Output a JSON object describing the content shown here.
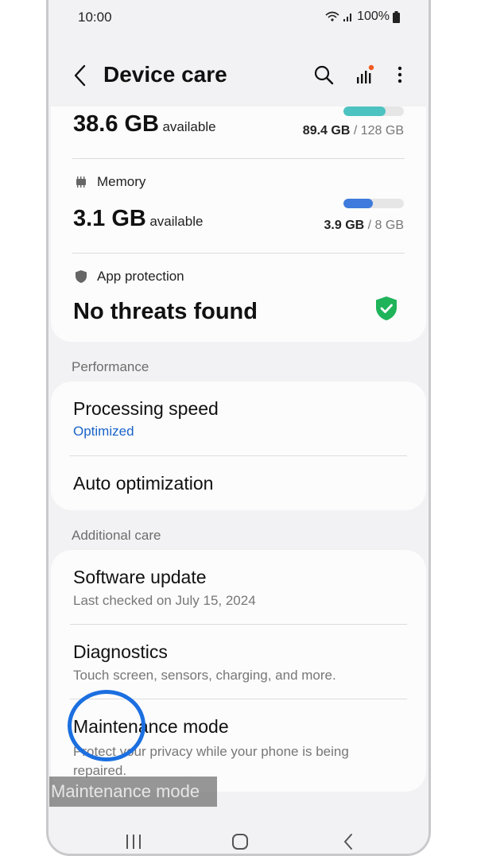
{
  "status_bar": {
    "time": "10:00",
    "battery": "100%"
  },
  "header": {
    "title": "Device care"
  },
  "storage": {
    "available_value": "38.6 GB",
    "available_label": "available",
    "used": "89.4 GB",
    "total": "/ 128 GB",
    "fill_fraction": 0.7,
    "color": "#4cc3c0"
  },
  "memory": {
    "label": "Memory",
    "available_value": "3.1 GB",
    "available_label": "available",
    "used": "3.9 GB",
    "total": "/ 8 GB",
    "fill_fraction": 0.49,
    "color": "#3e7bdc"
  },
  "app_protection": {
    "label": "App protection",
    "status": "No threats found",
    "color": "#1fb35a"
  },
  "performance": {
    "header": "Performance",
    "items": [
      {
        "title": "Processing speed",
        "subtitle": "Optimized",
        "subtitle_color": "#1a64c8"
      },
      {
        "title": "Auto optimization"
      }
    ]
  },
  "additional_care": {
    "header": "Additional care",
    "items": [
      {
        "title": "Software update",
        "subtitle": "Last checked on July 15, 2024"
      },
      {
        "title": "Diagnostics",
        "subtitle": "Touch screen, sensors, charging, and more."
      },
      {
        "title": "Maintenance mode",
        "subtitle": "Protect your privacy while your phone is being repaired."
      }
    ]
  },
  "tooltip": "Maintenance mode",
  "highlight_color": "#1b6fe0"
}
